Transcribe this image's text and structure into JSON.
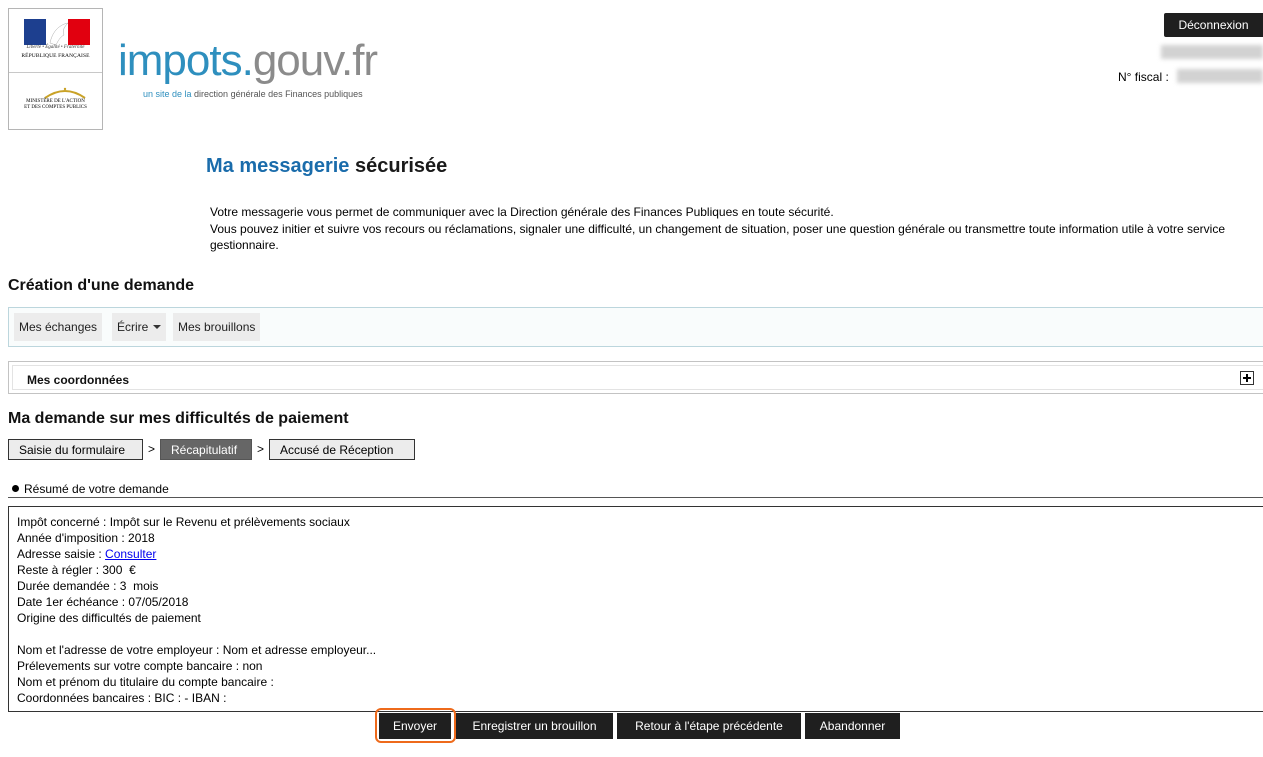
{
  "header": {
    "motto": "Liberté • Égalité • Fraternité",
    "republic": "RÉPUBLIQUE FRANÇAISE",
    "ministry_line1": "MINISTÈRE DE L'ACTION",
    "ministry_line2": "ET DES COMPTES PUBLICS",
    "brand_part1": "impots.",
    "brand_part2": "gouv.fr",
    "brand_sub_part1": "un site de la",
    "brand_sub_part2": " direction générale des Finances publiques",
    "logout_label": "Déconnexion",
    "fiscal_label": "N° fiscal :"
  },
  "page": {
    "title_part1": "Ma messagerie",
    "title_part2": " sécurisée",
    "intro_line1": "Votre messagerie vous permet de communiquer avec la Direction générale des Finances Publiques en toute sécurité.",
    "intro_line2": "Vous pouvez initier et suivre vos recours ou réclamations, signaler une difficulté, un changement de situation, poser une question générale ou transmettre toute information utile à votre service gestionnaire."
  },
  "creation": {
    "heading": "Création d'une demande",
    "toolbar": {
      "exchanges": "Mes échanges",
      "write": "Écrire",
      "drafts": "Mes brouillons"
    },
    "coordinates_title": "Mes coordonnées"
  },
  "request": {
    "heading": "Ma demande sur mes difficultés de paiement",
    "steps": [
      "Saisie du formulaire",
      "Récapitulatif",
      "Accusé de Réception"
    ],
    "step_separator": ">",
    "summary_title": "Résumé de votre demande",
    "summary": {
      "impot_label": "Impôt concerné : ",
      "impot_value": "Impôt sur le Revenu et prélèvements sociaux",
      "annee_label": "Année d'imposition : ",
      "annee_value": "2018",
      "adresse_label": "Adresse saisie : ",
      "adresse_link": "Consulter",
      "reste_label": "Reste à régler : ",
      "reste_value": "300",
      "reste_unit": "€",
      "duree_label": "Durée demandée : ",
      "duree_value": "3",
      "duree_unit": "mois",
      "date_label": "Date 1er échéance : ",
      "date_value": "07/05/2018",
      "origine": "Origine des difficultés de paiement",
      "employeur_label": "Nom et l'adresse de votre employeur : ",
      "employeur_value": "Nom et adresse employeur...",
      "prelevement_label": "Prélevements sur votre compte bancaire : ",
      "prelevement_value": "non",
      "titulaire_label": "Nom et prénom du titulaire du compte bancaire :",
      "bancaire": "Coordonnées bancaires : BIC : - IBAN :"
    }
  },
  "actions": {
    "send": "Envoyer",
    "save_draft": "Enregistrer un brouillon",
    "back": "Retour à l'étape précédente",
    "abandon": "Abandonner"
  },
  "colors": {
    "brand_blue": "#2e8fbe",
    "title_blue": "#1a6cab",
    "highlight": "#ee6a1b"
  }
}
